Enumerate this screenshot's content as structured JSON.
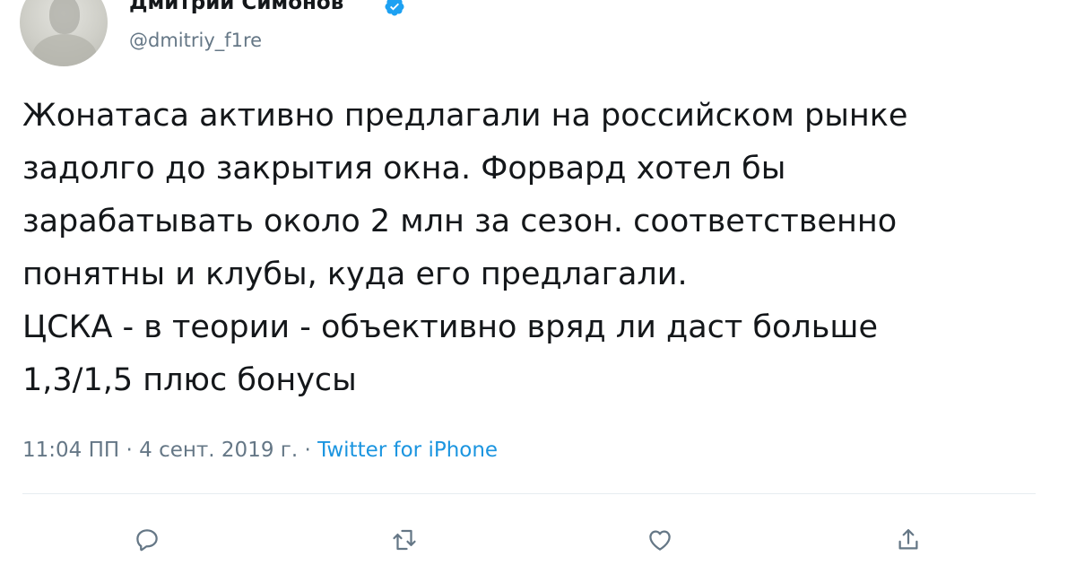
{
  "author": {
    "name": "Дмитрий Симонов",
    "handle": "@dmitriy_f1re",
    "verified": true
  },
  "tweet": {
    "lines": [
      "Жонатаса активно предлагали на российском рынке",
      "задолго до закрытия окна. Форвард хотел бы",
      "зарабатывать около 2 млн за сезон. соответственно",
      "понятны и клубы, куда его предлагали.",
      "ЦСКА - в теории - объективно вряд ли даст больше",
      "1,3/1,5 плюс бонусы"
    ]
  },
  "meta": {
    "time": "11:04 ПП",
    "sep1": " · ",
    "date": "4 сент. 2019 г.",
    "sep2": " · ",
    "source": "Twitter for iPhone"
  },
  "actions": [
    "reply-icon",
    "retweet-icon",
    "like-icon",
    "share-icon"
  ],
  "colors": {
    "text": "#14171a",
    "secondary": "#657786",
    "link": "#1b95e0",
    "verified": "#1da1f2",
    "divider": "#e6ecf0"
  }
}
